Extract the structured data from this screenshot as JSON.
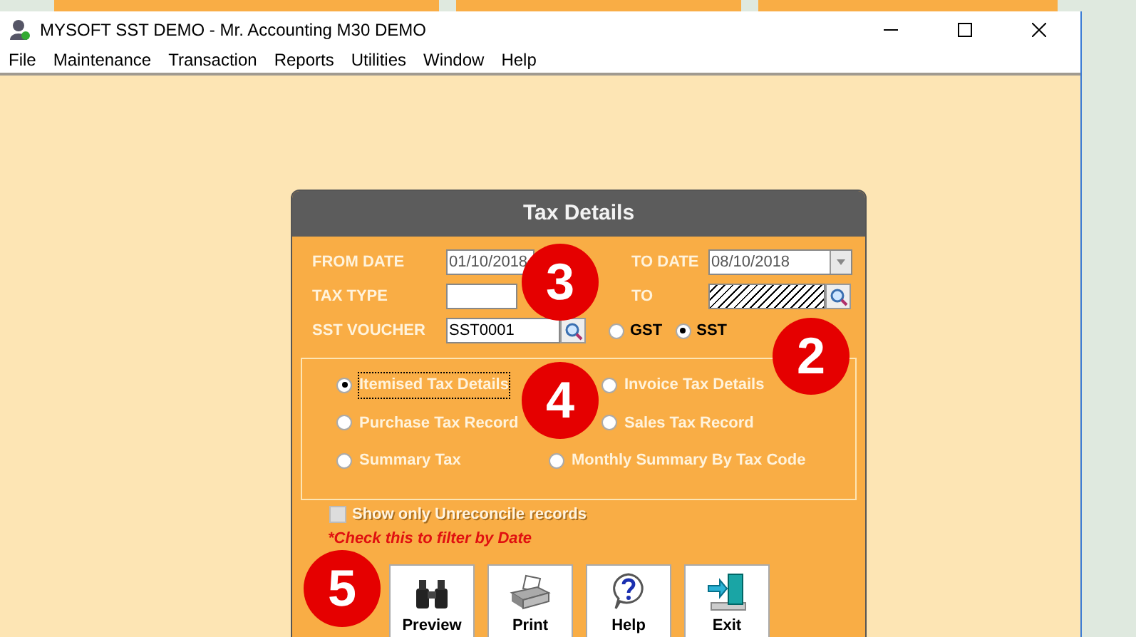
{
  "window": {
    "title": "MYSOFT SST DEMO - Mr. Accounting M30 DEMO"
  },
  "menu": [
    "File",
    "Maintenance",
    "Transaction",
    "Reports",
    "Utilities",
    "Window",
    "Help"
  ],
  "dialog": {
    "title": "Tax Details",
    "from_date": {
      "label": "FROM DATE",
      "value": "01/10/2018"
    },
    "to_date": {
      "label": "TO DATE",
      "value": "08/10/2018"
    },
    "tax_type": {
      "label": "TAX TYPE"
    },
    "tax_type_to": {
      "label": "TO"
    },
    "sst_voucher": {
      "label": "SST VOUCHER",
      "value": "SST0001"
    },
    "tax_mode": [
      {
        "label": "GST",
        "selected": false
      },
      {
        "label": "SST",
        "selected": true
      }
    ],
    "report_types": [
      {
        "label": "Itemised Tax Details",
        "selected": true
      },
      {
        "label": "Invoice Tax Details",
        "selected": false
      },
      {
        "label": "Purchase Tax Record",
        "selected": false
      },
      {
        "label": "Sales Tax Record",
        "selected": false
      },
      {
        "label": "Summary Tax",
        "selected": false
      },
      {
        "label": "Monthly Summary By Tax Code",
        "selected": false
      }
    ],
    "unreconciled": {
      "label": "Show only Unreconcile records",
      "checked": false,
      "disabled": true
    },
    "note": "*Check this to filter by Date",
    "buttons": [
      {
        "kind": "preview",
        "label": "Preview"
      },
      {
        "kind": "print",
        "label": "Print"
      },
      {
        "kind": "help",
        "label": "Help"
      },
      {
        "kind": "exit",
        "label": "Exit"
      }
    ]
  },
  "callouts": [
    "3",
    "2",
    "4",
    "5"
  ]
}
